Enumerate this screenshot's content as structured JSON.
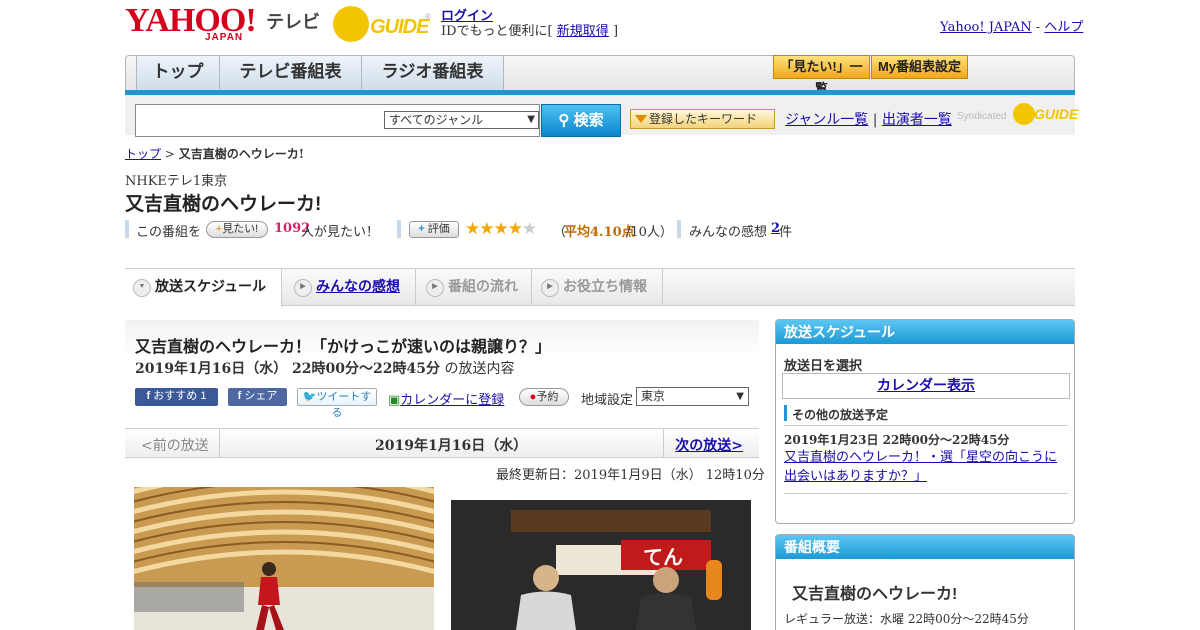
{
  "header": {
    "logo_main": "YAHOO!",
    "logo_sub": "JAPAN",
    "logo_tv": "テレビ",
    "gguide_brand": "G GUIDE",
    "gguide_reg": "®",
    "login": "ログイン",
    "login_sub_prefix": "IDでもっと便利に[",
    "register": "新規取得",
    "login_sub_suffix": "]",
    "yahoo_japan": "Yahoo! JAPAN",
    "separator": "-",
    "help": "ヘルプ"
  },
  "nav": {
    "tabs": [
      "トップ",
      "テレビ番組表",
      "ラジオ番組表"
    ],
    "want_list": "「見たい!」一覧",
    "my_schedule": "My番組表設定"
  },
  "search": {
    "genre_selected": "すべてのジャンル",
    "search_button": "検索",
    "keyword_button": "登録したキーワード",
    "genre_list": "ジャンル一覧",
    "divider": "|",
    "performer_list": "出演者一覧",
    "syndicated": "Syndicated",
    "synd_logo": "GUIDE"
  },
  "breadcrumb": {
    "top": "トップ",
    "sep": ">",
    "current": "又吉直樹のヘウレーカ!"
  },
  "program": {
    "station": "NHKEテレ1東京",
    "title": "又吉直樹のヘウレーカ!",
    "want_prefix": "この番組を",
    "want_button": "見たい!",
    "want_count": "1092",
    "want_suffix": "人が見たい！",
    "rate_button": "評価",
    "stars": "★★★★★",
    "rating_open": "（",
    "rating_label": "平均4.10点",
    "rating_count": "/10人）",
    "reviews_label": "みんなの感想",
    "reviews_count": "2",
    "reviews_suffix": "件"
  },
  "subtabs": [
    "放送スケジュール",
    "みんなの感想",
    "番組の流れ",
    "お役立ち情報"
  ],
  "episode": {
    "title": "又吉直樹のヘウレーカ！「かけっこが速いのは親譲り？」",
    "date": "2019年1月16日（水）  22時00分～22時45分",
    "date_suffix": "の放送内容",
    "fb_recommend": "おすすめ",
    "fb_count": "1",
    "fb_share": "シェア",
    "tweet": "ツイートする",
    "calendar": "カレンダーに登録",
    "reserve": "予約",
    "region_label": "地域設定",
    "region_value": "東京",
    "prev": "<前の放送",
    "current": "2019年1月16日（水）",
    "next": "次の放送>",
    "updated": "最終更新日：2019年1月9日（水） 12時10分"
  },
  "right": {
    "schedule_head": "放送スケジュール",
    "select_date": "放送日を選択",
    "calendar": "カレンダー表示",
    "other_head": "その他の放送予定",
    "other_date": "2019年1月23日  22時00分～22時45分",
    "other_link": "又吉直樹のヘウレーカ！・選「星空の向こうに出会いはありますか？」",
    "summary_head": "番組概要",
    "summary_title": "又吉直樹のヘウレーカ!",
    "summary_regular": "レギュラー放送：水曜 22時00分～22時45分"
  },
  "images": {
    "img2_sign": "てん"
  },
  "colors": {
    "accent_blue": "#1f95d4",
    "yahoo_red": "#d6001c",
    "gguide_yellow": "#f2c500",
    "want_pink": "#d0246d"
  }
}
